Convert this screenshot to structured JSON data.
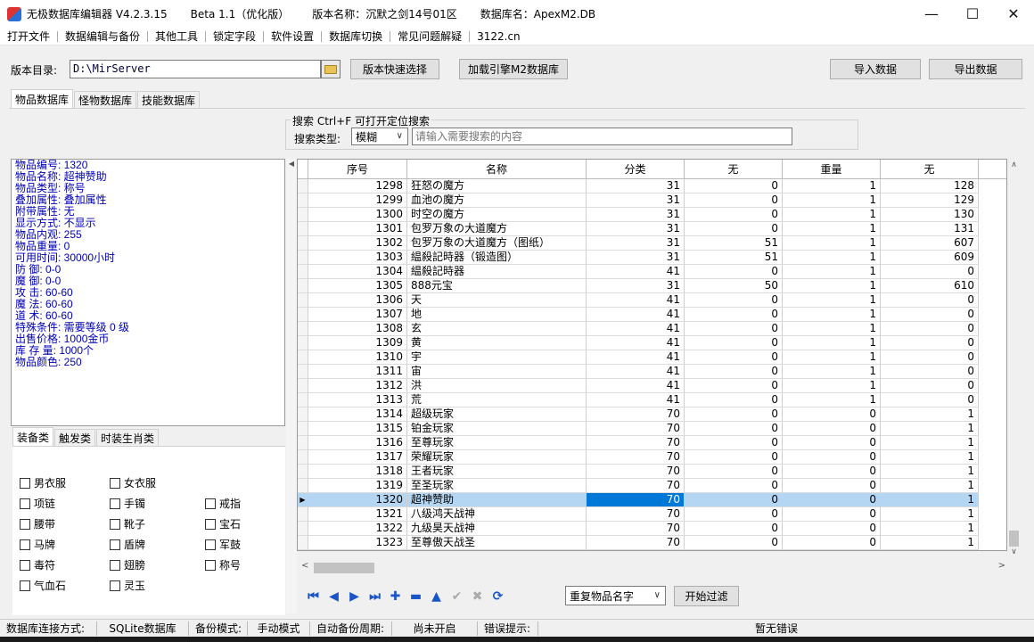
{
  "window": {
    "title_segments": [
      "无极数据库编辑器 V4.2.3.15",
      "Beta 1.1（优化版）",
      "版本名称：沉默之剑14号01区",
      "数据库名：ApexM2.DB"
    ],
    "minimize": "—",
    "maximize": "☐",
    "close": "✕"
  },
  "menu": [
    "打开文件",
    "数据编辑与备份",
    "其他工具",
    "锁定字段",
    "软件设置",
    "数据库切换",
    "常见问题解疑",
    "3122.cn"
  ],
  "toolbar": {
    "dir_label": "版本目录:",
    "dir_value": "D:\\MirServer",
    "quick_select": "版本快速选择",
    "load_engine": "加载引擎M2数据库",
    "import": "导入数据",
    "export": "导出数据"
  },
  "db_tabs": [
    "物品数据库",
    "怪物数据库",
    "技能数据库"
  ],
  "search": {
    "title": "搜索  Ctrl+F 可打开定位搜索",
    "type_label": "搜索类型:",
    "type_value": "模糊",
    "placeholder": "请输入需要搜索的内容"
  },
  "item_info": [
    "物品编号: 1320",
    "物品名称: 超神赞助",
    "物品类型: 称号",
    "叠加属性: 叠加属性",
    "附带属性: 无",
    "显示方式: 不显示",
    "物品内观: 255",
    "物品重量: 0",
    "可用时间: 30000小时",
    "防     御: 0-0",
    "魔     御: 0-0",
    "攻     击: 60-60",
    "魔     法: 60-60",
    "道     术: 60-60",
    "特殊条件: 需要等级 0 级",
    "出售价格: 1000金币",
    "库 存 量: 1000个",
    "物品颜色: 250"
  ],
  "category_tabs": [
    "装备类",
    "触发类",
    "时装生肖类"
  ],
  "equipment_checkboxes": [
    "男衣服",
    "女衣服",
    "项链",
    "手镯",
    "戒指",
    "腰带",
    "靴子",
    "宝石",
    "马牌",
    "盾牌",
    "军鼓",
    "毒符",
    "翅膀",
    "称号",
    "气血石",
    "灵玉"
  ],
  "grid": {
    "columns": [
      "序号",
      "名称",
      "分类",
      "无",
      "重量",
      "无"
    ],
    "selected_index": 22,
    "rows": [
      [
        "1298",
        "狂怒の魔方",
        "31",
        "0",
        "1",
        "128"
      ],
      [
        "1299",
        "血池の魔方",
        "31",
        "0",
        "1",
        "129"
      ],
      [
        "1300",
        "时空の魔方",
        "31",
        "0",
        "1",
        "130"
      ],
      [
        "1301",
        "包罗万象の大道魔方",
        "31",
        "0",
        "1",
        "131"
      ],
      [
        "1302",
        "包罗万象の大道魔方（图纸）",
        "31",
        "51",
        "1",
        "607"
      ],
      [
        "1303",
        "緼殺記時器（锻造图）",
        "31",
        "51",
        "1",
        "609"
      ],
      [
        "1304",
        "緼殺記時器",
        "41",
        "0",
        "1",
        "0"
      ],
      [
        "1305",
        "888元宝",
        "31",
        "50",
        "1",
        "610"
      ],
      [
        "1306",
        "天",
        "41",
        "0",
        "1",
        "0"
      ],
      [
        "1307",
        "地",
        "41",
        "0",
        "1",
        "0"
      ],
      [
        "1308",
        "玄",
        "41",
        "0",
        "1",
        "0"
      ],
      [
        "1309",
        "黄",
        "41",
        "0",
        "1",
        "0"
      ],
      [
        "1310",
        "宇",
        "41",
        "0",
        "1",
        "0"
      ],
      [
        "1311",
        "宙",
        "41",
        "0",
        "1",
        "0"
      ],
      [
        "1312",
        "洪",
        "41",
        "0",
        "1",
        "0"
      ],
      [
        "1313",
        "荒",
        "41",
        "0",
        "1",
        "0"
      ],
      [
        "1314",
        "超级玩家",
        "70",
        "0",
        "0",
        "1"
      ],
      [
        "1315",
        "铂金玩家",
        "70",
        "0",
        "0",
        "1"
      ],
      [
        "1316",
        "至尊玩家",
        "70",
        "0",
        "0",
        "1"
      ],
      [
        "1317",
        "荣耀玩家",
        "70",
        "0",
        "0",
        "1"
      ],
      [
        "1318",
        "王者玩家",
        "70",
        "0",
        "0",
        "1"
      ],
      [
        "1319",
        "至圣玩家",
        "70",
        "0",
        "0",
        "1"
      ],
      [
        "1320",
        "超神赞助",
        "70",
        "0",
        "0",
        "1"
      ],
      [
        "1321",
        "八级鸿天战神",
        "70",
        "0",
        "0",
        "1"
      ],
      [
        "1322",
        "九级昊天战神",
        "70",
        "0",
        "0",
        "1"
      ],
      [
        "1323",
        "至尊傲天战圣",
        "70",
        "0",
        "0",
        "1"
      ]
    ]
  },
  "nav": {
    "first": "first-icon",
    "prev": "prev-icon",
    "next": "next-icon",
    "last": "last-icon",
    "add": "add-icon",
    "delete": "delete-icon",
    "edit": "edit-icon",
    "post": "check-icon",
    "cancel": "cancel-icon",
    "refresh": "refresh-icon"
  },
  "filter": {
    "select_value": "重复物品名字",
    "button": "开始过滤"
  },
  "status": {
    "conn_label": "数据库连接方式:",
    "conn_value": "SQLite数据库",
    "backup_label": "备份模式:",
    "backup_value": "手动模式",
    "auto_label": "自动备份周期:",
    "auto_value": "尚未开启",
    "error_label": "错误提示:",
    "error_value": "暂无错误"
  },
  "colors": {
    "info_text": "#0000b4",
    "selection": "#0078d7",
    "row_highlight": "#b5d6f3",
    "nav_icon": "#1a55c8"
  }
}
